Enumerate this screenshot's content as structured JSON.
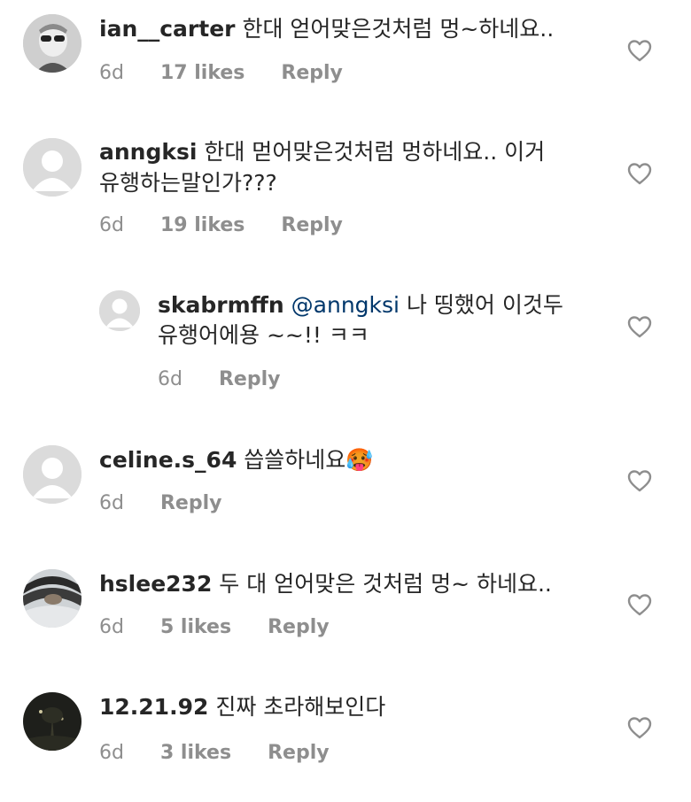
{
  "comments": [
    {
      "username": "ian__carter",
      "text": "한대 얻어맞은것처럼 멍~하네요..",
      "time": "6d",
      "likes": "17 likes",
      "reply": "Reply",
      "avatar_icon": "profile-photo"
    },
    {
      "username": "anngksi",
      "text_line1": "한대 먿어맞은것처럼 멍하네요.. 이거",
      "text_line2": "유행하는말인가???",
      "time": "6d",
      "likes": "19 likes",
      "reply": "Reply",
      "avatar_icon": "default-avatar"
    },
    {
      "username": "skabrmffn",
      "mention": "@anngksi",
      "text_line1": "나 띵했어 이것두",
      "text_line2": "유행어에용 ~~!! ㅋㅋ",
      "time": "6d",
      "reply": "Reply",
      "avatar_icon": "default-avatar"
    },
    {
      "username": "celine.s_64",
      "text": "씁쓸하네요🥵",
      "time": "6d",
      "reply": "Reply",
      "avatar_icon": "default-avatar"
    },
    {
      "username": "hslee232",
      "text": "두 대 얻어맞은 것처럼 멍~ 하네요..",
      "time": "6d",
      "likes": "5 likes",
      "reply": "Reply",
      "avatar_icon": "profile-photo"
    },
    {
      "username": "12.21.92",
      "text": "진짜 초라해보인다",
      "time": "6d",
      "likes": "3 likes",
      "reply": "Reply",
      "avatar_icon": "profile-photo"
    }
  ],
  "colors": {
    "text": "#262626",
    "meta": "#8e8e8e",
    "mention": "#00376b",
    "avatar_placeholder": "#dbdbdb"
  }
}
